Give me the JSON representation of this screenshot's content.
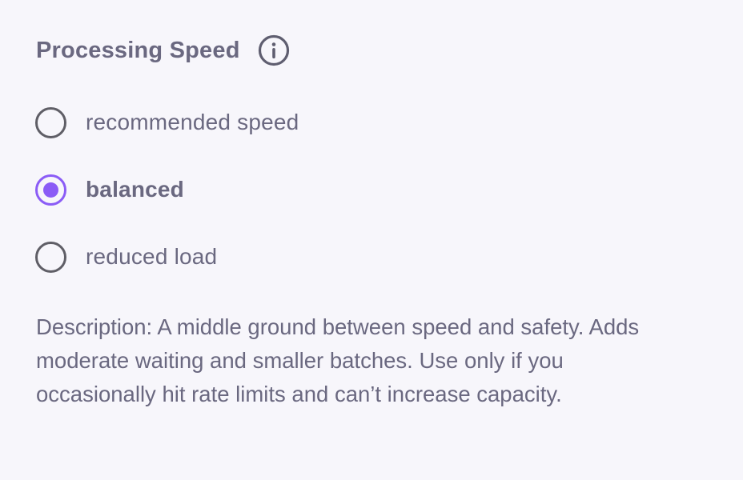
{
  "section": {
    "title": "Processing Speed",
    "info_icon": "info-circle-icon"
  },
  "options": [
    {
      "label": "recommended speed",
      "selected": false
    },
    {
      "label": "balanced",
      "selected": true
    },
    {
      "label": "reduced load",
      "selected": false
    }
  ],
  "description": "Description: A middle ground between speed and safety. Adds moderate waiting and smaller batches. Use only if you occasionally hit rate limits and can’t increase capacity.",
  "colors": {
    "background": "#f7f6fb",
    "text": "#6a6880",
    "radio_border": "#5f5e66",
    "accent": "#8b5cf6"
  }
}
